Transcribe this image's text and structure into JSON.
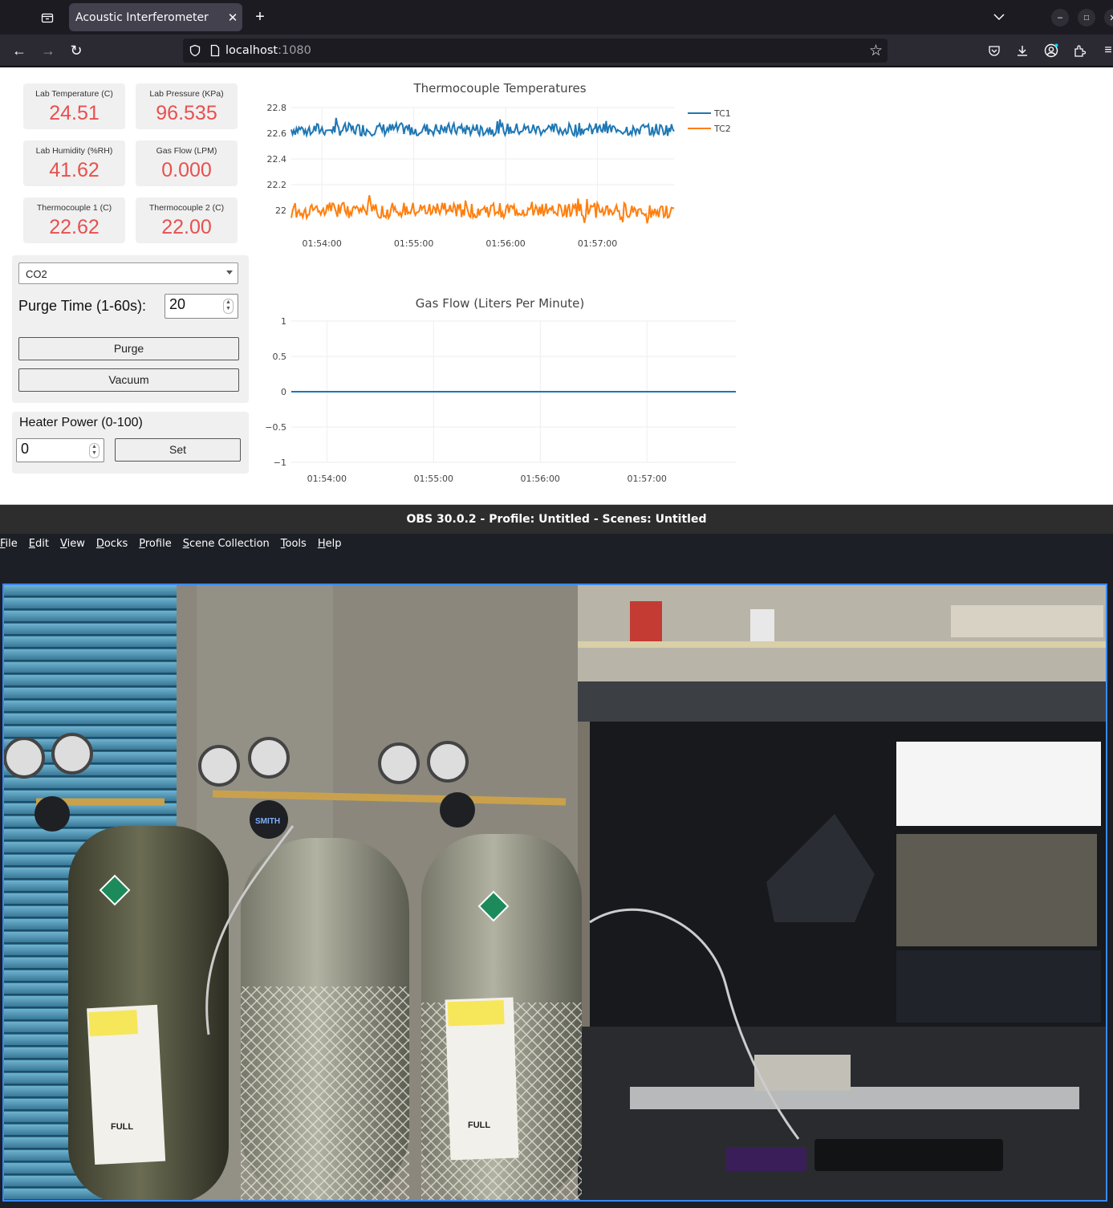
{
  "browser": {
    "tab_title": "Acoustic Interferometer",
    "url_host": "localhost",
    "url_port": ":1080"
  },
  "cards": [
    {
      "label": "Lab Temperature (C)",
      "value": "24.51"
    },
    {
      "label": "Lab Pressure (KPa)",
      "value": "96.535"
    },
    {
      "label": "Lab Humidity (%RH)",
      "value": "41.62"
    },
    {
      "label": "Gas Flow (LPM)",
      "value": "0.000"
    },
    {
      "label": "Thermocouple 1 (C)",
      "value": "22.62"
    },
    {
      "label": "Thermocouple 2 (C)",
      "value": "22.00"
    }
  ],
  "controls": {
    "gas_selected": "CO2",
    "purge_label": "Purge Time (1-60s):",
    "purge_value": "20",
    "purge_button": "Purge",
    "vacuum_button": "Vacuum",
    "heater_label": "Heater Power (0-100)",
    "heater_value": "0",
    "set_button": "Set"
  },
  "chart_data": [
    {
      "type": "line",
      "title": "Thermocouple Temperatures",
      "x_ticks": [
        "01:54:00",
        "01:55:00",
        "01:56:00",
        "01:57:00"
      ],
      "x_range": [
        "01:53:40",
        "01:57:50"
      ],
      "y_ticks": [
        "22.8",
        "22.6",
        "22.4",
        "22.2",
        "22"
      ],
      "ylim": [
        21.95,
        22.8
      ],
      "legend": "right",
      "series": [
        {
          "name": "TC1",
          "color": "#1f77b4",
          "mean": 22.63,
          "noise": 0.05
        },
        {
          "name": "TC2",
          "color": "#ff7f0e",
          "mean": 22.0,
          "noise": 0.06
        }
      ]
    },
    {
      "type": "line",
      "title": "Gas Flow (Liters Per Minute)",
      "x_ticks": [
        "01:54:00",
        "01:55:00",
        "01:56:00",
        "01:57:00"
      ],
      "x_range": [
        "01:53:40",
        "01:57:50"
      ],
      "y_ticks": [
        "1",
        "0.5",
        "0",
        "−0.5",
        "−1"
      ],
      "ylim": [
        -1,
        1
      ],
      "series": [
        {
          "color": "#1f77b4",
          "values": [
            0,
            0
          ]
        }
      ]
    }
  ],
  "obs": {
    "title": "OBS 30.0.2 - Profile: Untitled - Scenes: Untitled",
    "menu": [
      {
        "mn": "F",
        "rest": "ile"
      },
      {
        "mn": "E",
        "rest": "dit"
      },
      {
        "mn": "V",
        "rest": "iew"
      },
      {
        "mn": "D",
        "rest": "ocks"
      },
      {
        "mn": "P",
        "rest": "rofile"
      },
      {
        "mn": "S",
        "rest": "cene Collection"
      },
      {
        "mn": "T",
        "rest": "ools"
      },
      {
        "mn": "H",
        "rest": "elp"
      }
    ]
  },
  "camera": {
    "label_full_1": "FULL",
    "label_full_2": "FULL",
    "label_smith": "SMITH"
  }
}
